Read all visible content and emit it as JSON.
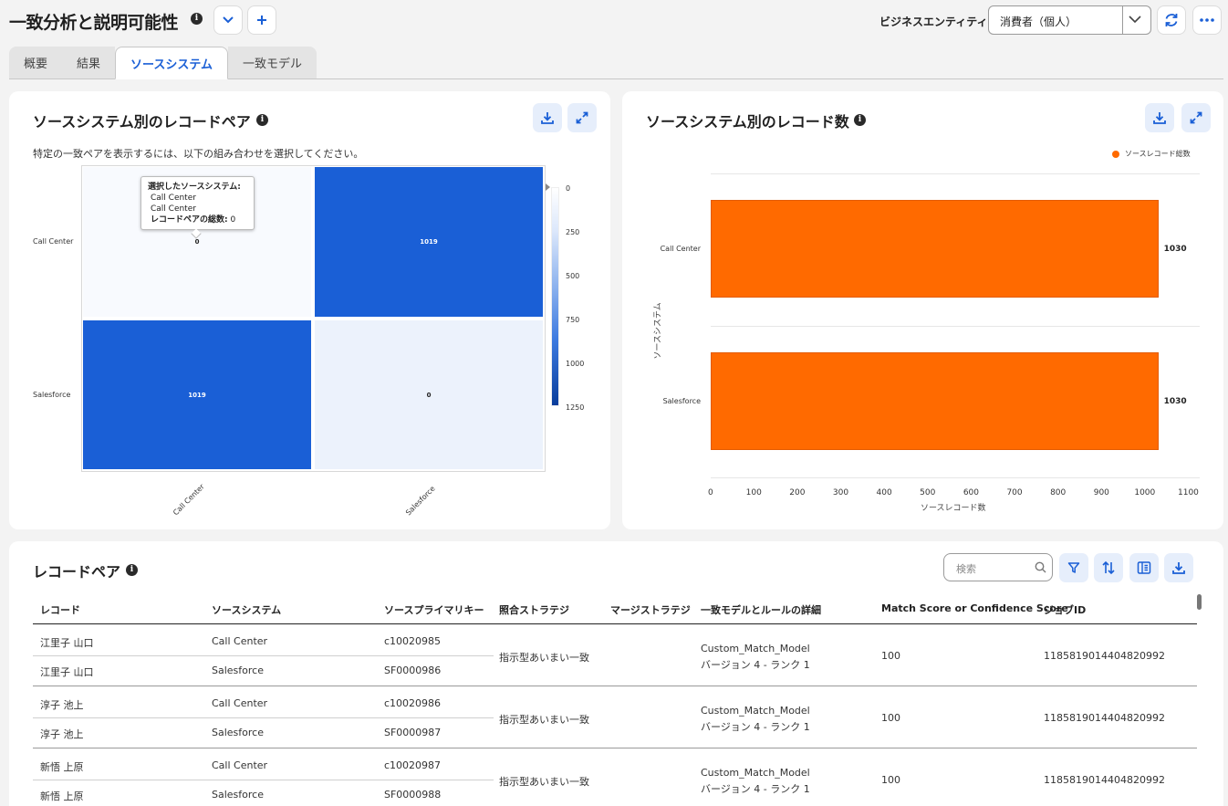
{
  "header": {
    "title": "一致分析と説明可能性",
    "business_entity_label": "ビジネスエンティティ:",
    "business_entity_value": "消費者（個人）"
  },
  "tabs": [
    {
      "label": "概要"
    },
    {
      "label": "結果"
    },
    {
      "label": "ソースシステム",
      "active": true
    },
    {
      "label": "一致モデル"
    }
  ],
  "heatmap_card": {
    "title": "ソースシステム別のレコードペア",
    "description": "特定の一致ペアを表示するには、以下の組み合わせを選択してください。",
    "tooltip": {
      "heading": "選択したソースシステム:",
      "line1": "Call Center",
      "line2": "Call Center",
      "total_label": "レコードペアの総数:",
      "total_value": "0"
    }
  },
  "bar_card": {
    "title": "ソースシステム別のレコード数"
  },
  "chart_data": [
    {
      "type": "heatmap",
      "rows": [
        "Call Center",
        "Salesforce"
      ],
      "columns": [
        "Call Center",
        "Salesforce"
      ],
      "values": [
        [
          0,
          1019
        ],
        [
          1019,
          0
        ]
      ],
      "value_labels": [
        [
          "0",
          "1019"
        ],
        [
          "1019",
          "0"
        ]
      ],
      "colorbar_ticks": [
        "0",
        "250",
        "500",
        "750",
        "1000",
        "1250"
      ],
      "colorbar_range": [
        0,
        1250
      ]
    },
    {
      "type": "bar",
      "orientation": "horizontal",
      "categories": [
        "Call Center",
        "Salesforce"
      ],
      "series": [
        {
          "name": "ソースレコード総数",
          "values": [
            1030,
            1030
          ]
        }
      ],
      "value_labels": [
        "1030",
        "1030"
      ],
      "xlabel": "ソースレコード数",
      "ylabel": "ソースシステム",
      "xlim": [
        0,
        1100
      ],
      "x_ticks": [
        "0",
        "100",
        "200",
        "300",
        "400",
        "500",
        "600",
        "700",
        "800",
        "900",
        "1000",
        "1100"
      ],
      "legend_position": "top-right",
      "color": "#ff6a00"
    }
  ],
  "record_pairs": {
    "title": "レコードペア",
    "search_placeholder": "検索",
    "columns": [
      "レコード",
      "ソースシステム",
      "ソースプライマリキー",
      "照合ストラテジ",
      "マージストラテジ",
      "一致モデルとルールの詳細",
      "Match Score or Confidence Score",
      "ジョブID"
    ],
    "rows": [
      {
        "a": {
          "record": "江里子 山口",
          "source": "Call Center",
          "pk": "c10020985"
        },
        "b": {
          "record": "江里子 山口",
          "source": "Salesforce",
          "pk": "SF0000986"
        },
        "strategy": "指示型あいまい一致",
        "merge": "",
        "model": "Custom_Match_Model",
        "model_detail": "バージョン 4 - ランク 1",
        "score": "100",
        "job_id": "1185819014404820992"
      },
      {
        "a": {
          "record": "淳子 池上",
          "source": "Call Center",
          "pk": "c10020986"
        },
        "b": {
          "record": "淳子 池上",
          "source": "Salesforce",
          "pk": "SF0000987"
        },
        "strategy": "指示型あいまい一致",
        "merge": "",
        "model": "Custom_Match_Model",
        "model_detail": "バージョン 4 - ランク 1",
        "score": "100",
        "job_id": "1185819014404820992"
      },
      {
        "a": {
          "record": "新悟 上原",
          "source": "Call Center",
          "pk": "c10020987"
        },
        "b": {
          "record": "新悟 上原",
          "source": "Salesforce",
          "pk": "SF0000988"
        },
        "strategy": "指示型あいまい一致",
        "merge": "",
        "model": "Custom_Match_Model",
        "model_detail": "バージョン 4 - ランク 1",
        "score": "100",
        "job_id": "1185819014404820992"
      }
    ]
  },
  "colors": {
    "accent": "#1a5fd6",
    "bar": "#ff6a00",
    "heat_high": "#1a5fd6",
    "heat_low": "#f8fafe"
  }
}
